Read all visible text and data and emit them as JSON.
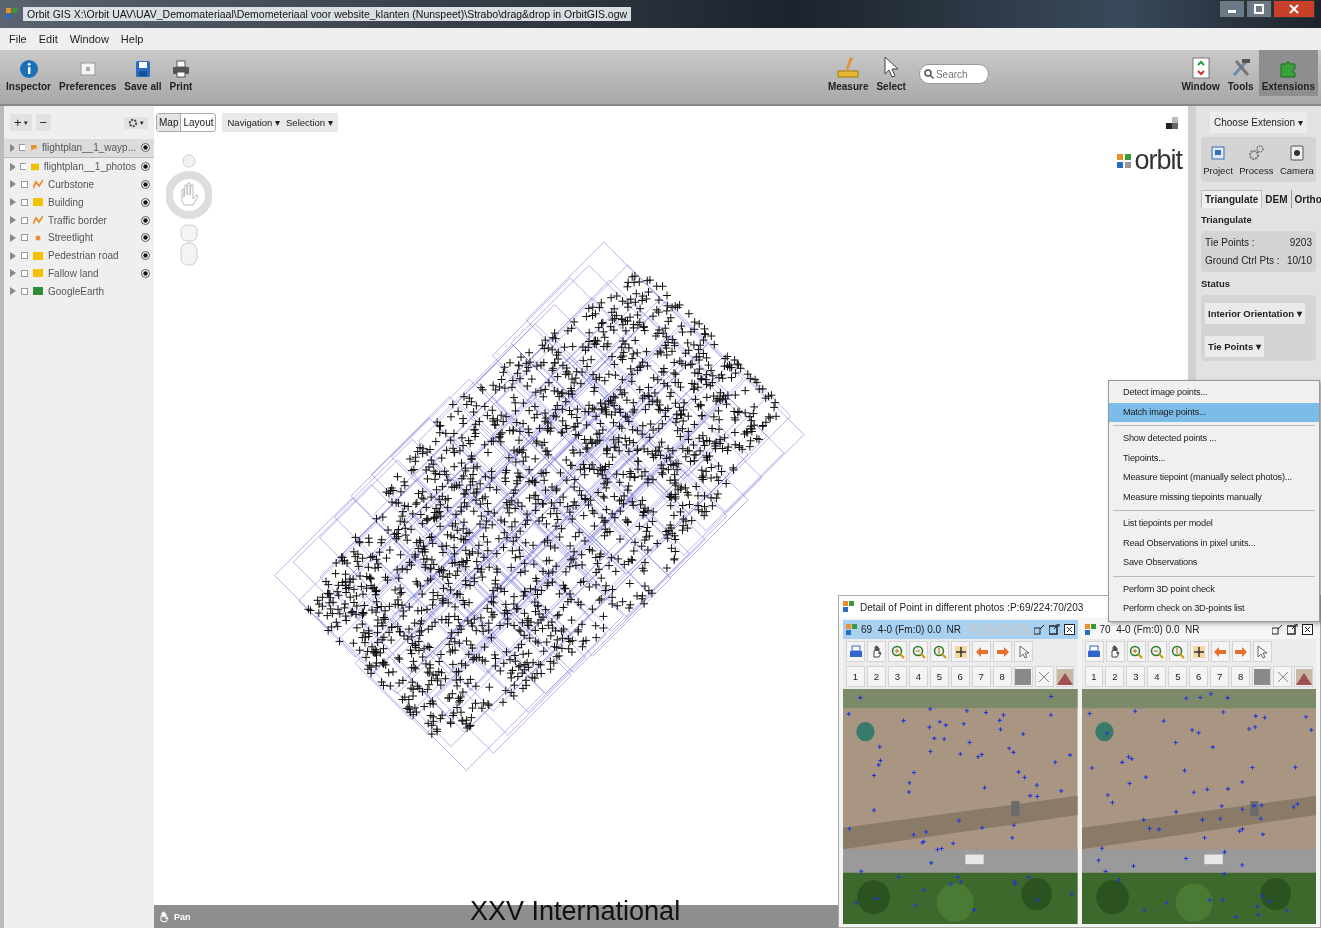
{
  "window": {
    "title": "Orbit GIS X:\\Orbit UAV\\UAV_Demomateriaal\\Demometeriaal voor website_klanten (Nunspeet)\\Strabo\\drag&drop in OrbitGIS.ogw"
  },
  "menu": [
    "File",
    "Edit",
    "Window",
    "Help"
  ],
  "toolbar": {
    "left": [
      {
        "kind": "info",
        "label": "Inspector",
        "selected": false
      },
      {
        "kind": "prefs",
        "label": "Preferences",
        "selected": false
      },
      {
        "kind": "save",
        "label": "Save all",
        "selected": false
      },
      {
        "kind": "print",
        "label": "Print",
        "selected": false
      }
    ],
    "center": [
      {
        "kind": "measure",
        "label": "Measure",
        "selected": false
      },
      {
        "kind": "select",
        "label": "Select",
        "selected": false
      }
    ],
    "search": {
      "placeholder": "Search"
    },
    "right": [
      {
        "kind": "window",
        "label": "Window",
        "selected": false
      },
      {
        "kind": "tools",
        "label": "Tools",
        "selected": false
      },
      {
        "kind": "extensions",
        "label": "Extensions",
        "selected": true
      }
    ]
  },
  "layer_panel": {
    "add": "+",
    "add_caret": "▾",
    "remove": "−",
    "gear_caret": "▾",
    "layers": [
      {
        "name": "flightplan__1_wayp...",
        "kind": "waypoint",
        "color": "#e8902c",
        "visible": true,
        "selected": true
      },
      {
        "name": "flightplan__1_photos",
        "kind": "polygon",
        "color": "#f2c200",
        "visible": true,
        "selected": false
      },
      {
        "name": "Curbstone",
        "kind": "line",
        "color": "#e8902c",
        "visible": true,
        "selected": false
      },
      {
        "name": "Building",
        "kind": "polygon",
        "color": "#f2c200",
        "visible": true,
        "selected": false
      },
      {
        "name": "Traffic border",
        "kind": "line",
        "color": "#e8902c",
        "visible": true,
        "selected": false
      },
      {
        "name": "Streetlight",
        "kind": "point",
        "color": "#e8902c",
        "visible": true,
        "selected": false
      },
      {
        "name": "Pedestrian road",
        "kind": "polygon",
        "color": "#f2c200",
        "visible": true,
        "selected": false
      },
      {
        "name": "Fallow land",
        "kind": "polygon",
        "color": "#f2c200",
        "visible": true,
        "selected": false
      },
      {
        "name": "GoogleEarth",
        "kind": "raster",
        "color": "#2e8b3a",
        "visible": false,
        "selected": false
      }
    ]
  },
  "map": {
    "view_tabs": [
      {
        "label": "Map",
        "selected": true
      },
      {
        "label": "Layout",
        "selected": false
      }
    ],
    "dropdowns": [
      "Navigation ▾",
      "Selection ▾"
    ],
    "logo": "orbit",
    "status": "Pan"
  },
  "extension_panel": {
    "choose": "Choose Extension ▾",
    "buttons": [
      {
        "kind": "project",
        "label": "Project"
      },
      {
        "kind": "process",
        "label": "Process"
      },
      {
        "kind": "camera",
        "label": "Camera"
      }
    ],
    "tabs": [
      {
        "label": "Triangulate",
        "selected": true
      },
      {
        "label": "DEM",
        "selected": false
      },
      {
        "label": "Ortho",
        "selected": false
      }
    ],
    "section": "Triangulate",
    "stats": [
      {
        "label": "Tie Points :",
        "value": "9203"
      },
      {
        "label": "Ground Ctrl Pts :",
        "value": "10/10"
      }
    ],
    "status_title": "Status",
    "status_dropdowns": [
      "Interior Orientation ▾",
      "Tie Points ▾"
    ]
  },
  "context_menu": [
    [
      {
        "label": "Detect image points...",
        "selected": false
      },
      {
        "label": "Match image points...",
        "selected": true
      }
    ],
    [
      {
        "label": "Show detected points ...",
        "selected": false
      },
      {
        "label": "Tiepoints...",
        "selected": false
      },
      {
        "label": "Measure tiepoint (manually select photos)...",
        "selected": false
      },
      {
        "label": "Measure missing tiepoints manually",
        "selected": false
      }
    ],
    [
      {
        "label": "List tiepoints per model",
        "selected": false
      },
      {
        "label": "Read Observations in pixel units...",
        "selected": false
      },
      {
        "label": "Save Observations",
        "selected": false
      }
    ],
    [
      {
        "label": "Perform 3D point check",
        "selected": false
      },
      {
        "label": "Perform check on 3D-points list",
        "selected": false
      }
    ]
  ],
  "detail_window": {
    "title": "Detail of Point in different photos :P:69/224:70/203",
    "panes": [
      {
        "title": "69  4-0 (Fm:0) 0.0  NR",
        "active": true,
        "numbers": [
          "1",
          "2",
          "3",
          "4",
          "5",
          "6",
          "7",
          "8"
        ]
      },
      {
        "title": "70  4-0 (Fm:0) 0.0  NR",
        "active": false,
        "numbers": [
          "1",
          "2",
          "3",
          "4",
          "5",
          "6",
          "7",
          "8"
        ]
      }
    ]
  },
  "caption": "XXV International"
}
